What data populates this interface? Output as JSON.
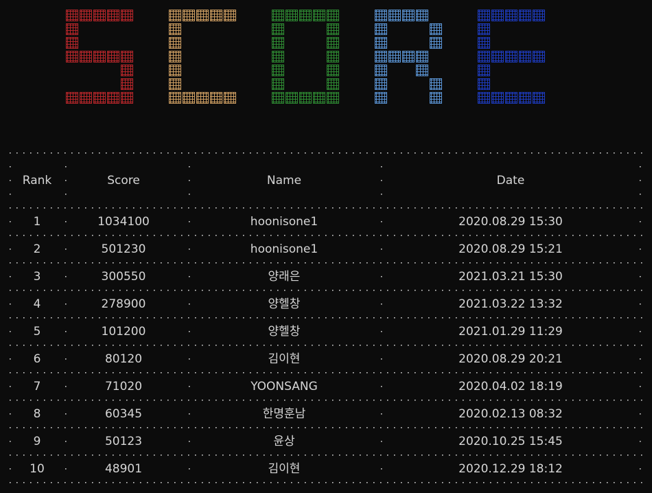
{
  "title": {
    "text": "SCORE",
    "letters": [
      {
        "char": "S",
        "color": "#b8262a",
        "pattern": [
          "11111",
          "10000",
          "10000",
          "11111",
          "00001",
          "00001",
          "11111"
        ]
      },
      {
        "char": "C",
        "color": "#cf9f62",
        "pattern": [
          "11111",
          "10000",
          "10000",
          "10000",
          "10000",
          "10000",
          "11111"
        ]
      },
      {
        "char": "O",
        "color": "#2e8a32",
        "pattern": [
          "11111",
          "10001",
          "10001",
          "10001",
          "10001",
          "10001",
          "11111"
        ]
      },
      {
        "char": "R",
        "color": "#5b95d6",
        "pattern": [
          "11110",
          "10001",
          "10001",
          "11110",
          "10010",
          "10001",
          "10001"
        ]
      },
      {
        "char": "E",
        "color": "#1d3bc0",
        "pattern": [
          "11111",
          "10000",
          "10000",
          "11111",
          "10000",
          "10000",
          "11111"
        ]
      }
    ]
  },
  "table": {
    "headers": {
      "rank": "Rank",
      "score": "Score",
      "name": "Name",
      "date": "Date"
    },
    "rows": [
      {
        "rank": "1",
        "score": "1034100",
        "name": "hoonisone1",
        "date": "2020.08.29 15:30"
      },
      {
        "rank": "2",
        "score": "501230",
        "name": "hoonisone1",
        "date": "2020.08.29 15:21"
      },
      {
        "rank": "3",
        "score": "300550",
        "name": "양래은",
        "date": "2021.03.21 15:30"
      },
      {
        "rank": "4",
        "score": "278900",
        "name": "양헬창",
        "date": "2021.03.22 13:32"
      },
      {
        "rank": "5",
        "score": "101200",
        "name": "양헬창",
        "date": "2021.01.29 11:29"
      },
      {
        "rank": "6",
        "score": "80120",
        "name": "김이현",
        "date": "2020.08.29 20:21"
      },
      {
        "rank": "7",
        "score": "71020",
        "name": "YOONSANG",
        "date": "2020.04.02 18:19"
      },
      {
        "rank": "8",
        "score": "60345",
        "name": "한명훈남",
        "date": "2020.02.13 08:32"
      },
      {
        "rank": "9",
        "score": "50123",
        "name": "윤상",
        "date": "2020.10.25 15:45"
      },
      {
        "rank": "10",
        "score": "48901",
        "name": "김이현",
        "date": "2020.12.29 18:12"
      }
    ]
  },
  "colors": {
    "background": "#0c0c0c",
    "text": "#d6d6d6",
    "dots": "#cfcfcf"
  }
}
